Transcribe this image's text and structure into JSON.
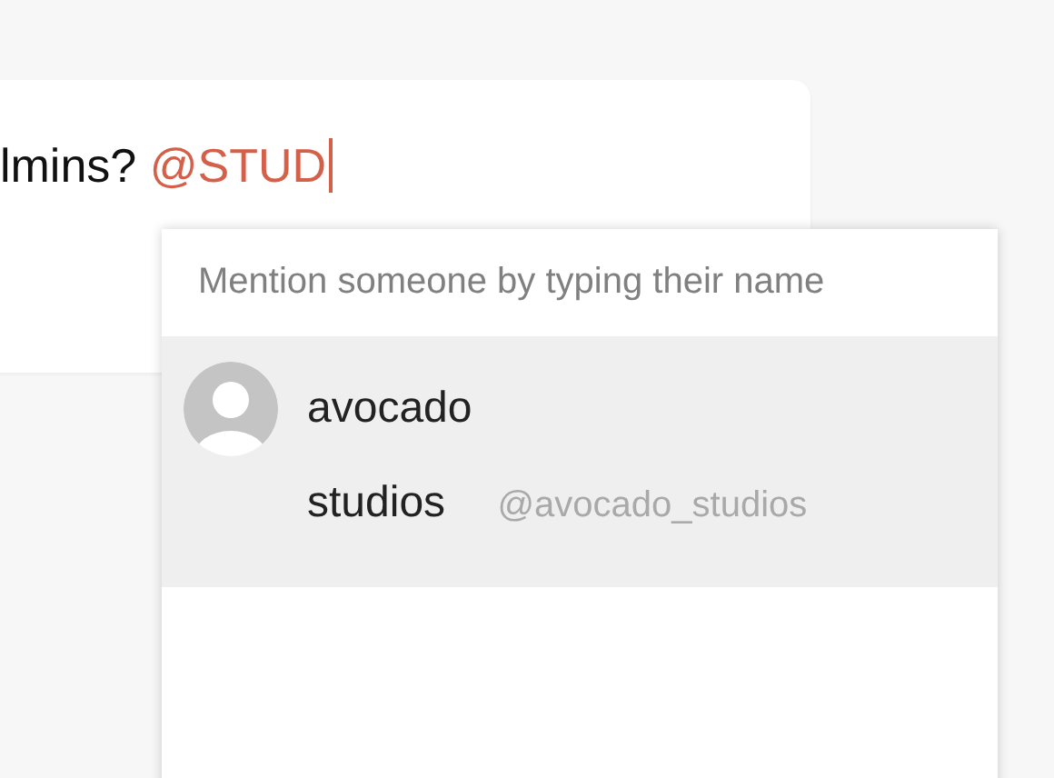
{
  "message": {
    "text": "lmins?",
    "mention": "@STUD"
  },
  "mention_popup": {
    "hint": "Mention someone by typing their name",
    "suggestions": [
      {
        "name": "avocado studios",
        "handle": "@avocado_studios",
        "selected": true
      }
    ]
  }
}
